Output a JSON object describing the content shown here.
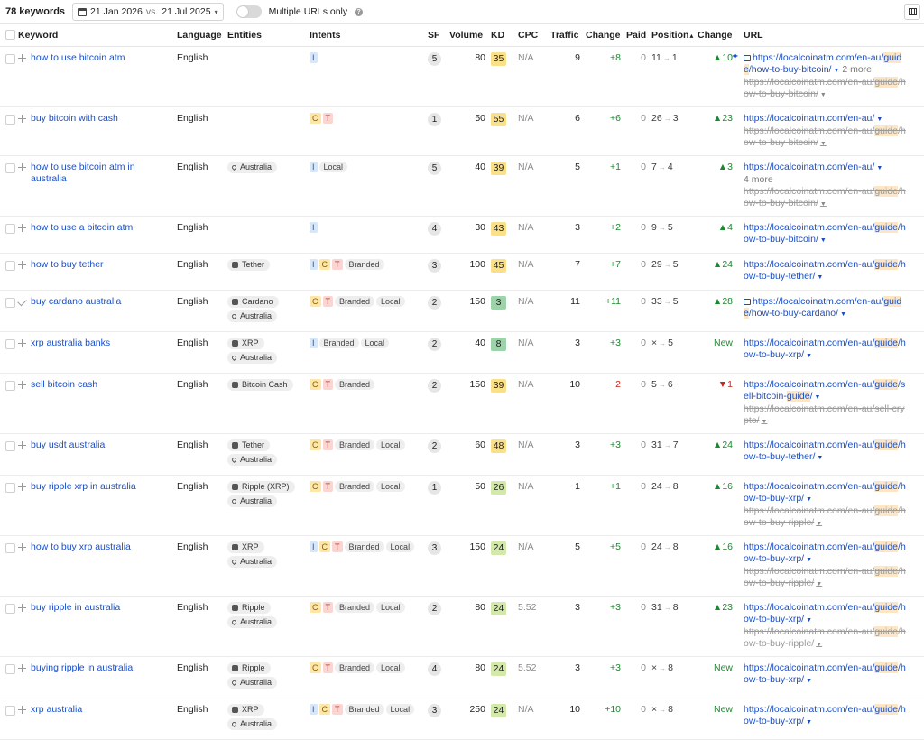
{
  "header": {
    "keyword_count": "78 keywords",
    "date_current": "21 Jan 2026",
    "vs": "vs.",
    "date_compare": "21 Jul 2025",
    "toggle_label": "Multiple URLs only",
    "help_glyph": "?"
  },
  "columns": [
    "Keyword",
    "Language",
    "Entities",
    "Intents",
    "SF",
    "Volume",
    "KD",
    "CPC",
    "Traffic",
    "Change",
    "Paid",
    "Position",
    "Change",
    "URL"
  ],
  "position_sort_glyph": "▴",
  "colors": {
    "link": "#1a4fc4",
    "green": "#1b8a2e",
    "red": "#c9261d",
    "kd_yellow": "#fbe08a",
    "kd_green": "#9cd3a8",
    "kd_lightgreen": "#d3e9a9"
  },
  "rows": [
    {
      "keyword": "how to use bitcoin atm",
      "language": "English",
      "entities": [],
      "intents": [
        "I"
      ],
      "sf": "5",
      "volume": "80",
      "kd": "35",
      "kd_color": "#fbe08a",
      "cpc": "N/A",
      "traffic": "9",
      "change": "+8",
      "change_dir": "up",
      "paid": "0",
      "pos_from": "11",
      "pos_to": "1",
      "pchange": "▲10",
      "pchange_dir": "up",
      "lead": "plus",
      "sparkle": true,
      "urls": [
        {
          "text": "https://localcoinatm.com/en-au/guid",
          "img": true
        },
        {
          "text": "e/how-to-buy-bitcoin/",
          "more": "2 more"
        },
        {
          "text": "https://localcoinatm.com/en-au/guide/h",
          "strike": true
        },
        {
          "text": "ow-to-buy-bitcoin/",
          "strike": true
        }
      ]
    },
    {
      "keyword": "buy bitcoin with cash",
      "language": "English",
      "entities": [],
      "intents": [
        "C",
        "T"
      ],
      "sf": "1",
      "volume": "50",
      "kd": "55",
      "kd_color": "#fbe08a",
      "cpc": "N/A",
      "traffic": "6",
      "change": "+6",
      "change_dir": "up",
      "paid": "0",
      "pos_from": "26",
      "pos_to": "3",
      "pchange": "▲23",
      "pchange_dir": "up",
      "lead": "plus",
      "urls": [
        {
          "text": "https://localcoinatm.com/en-au/"
        },
        {
          "text": "https://localcoinatm.com/en-au/guide/h",
          "strike": true
        },
        {
          "text": "ow-to-buy-bitcoin/",
          "strike": true
        }
      ]
    },
    {
      "keyword": "how to use bitcoin atm in australia",
      "language": "English",
      "entities": [
        "Australia"
      ],
      "intents": [
        "I",
        "Local"
      ],
      "sf": "5",
      "volume": "40",
      "kd": "39",
      "kd_color": "#fbe08a",
      "cpc": "N/A",
      "traffic": "5",
      "change": "+1",
      "change_dir": "up",
      "paid": "0",
      "pos_from": "7",
      "pos_to": "4",
      "pchange": "▲3",
      "pchange_dir": "up",
      "lead": "plus",
      "urls": [
        {
          "text": "https://localcoinatm.com/en-au/"
        },
        {
          "text": "4 more",
          "plain": true
        },
        {
          "text": "https://localcoinatm.com/en-au/guide/h",
          "strike": true
        },
        {
          "text": "ow-to-buy-bitcoin/",
          "strike": true
        }
      ]
    },
    {
      "keyword": "how to use a bitcoin atm",
      "language": "English",
      "entities": [],
      "intents": [
        "I"
      ],
      "sf": "4",
      "volume": "30",
      "kd": "43",
      "kd_color": "#fbe08a",
      "cpc": "N/A",
      "traffic": "3",
      "change": "+2",
      "change_dir": "up",
      "paid": "0",
      "pos_from": "9",
      "pos_to": "5",
      "pchange": "▲4",
      "pchange_dir": "up",
      "lead": "plus",
      "urls": [
        {
          "text": "https://localcoinatm.com/en-au/guide/h"
        },
        {
          "text": "ow-to-buy-bitcoin/"
        }
      ]
    },
    {
      "keyword": "how to buy tether",
      "language": "English",
      "entities": [
        "Tether"
      ],
      "intents": [
        "I",
        "C",
        "T",
        "Branded"
      ],
      "sf": "3",
      "volume": "100",
      "kd": "45",
      "kd_color": "#fbe08a",
      "cpc": "N/A",
      "traffic": "7",
      "change": "+7",
      "change_dir": "up",
      "paid": "0",
      "pos_from": "29",
      "pos_to": "5",
      "pchange": "▲24",
      "pchange_dir": "up",
      "lead": "plus",
      "urls": [
        {
          "text": "https://localcoinatm.com/en-au/guide/h"
        },
        {
          "text": "ow-to-buy-tether/"
        }
      ]
    },
    {
      "keyword": "buy cardano australia",
      "language": "English",
      "entities": [
        "Cardano",
        "Australia"
      ],
      "intents": [
        "C",
        "T",
        "Branded",
        "Local"
      ],
      "sf": "2",
      "volume": "150",
      "kd": "3",
      "kd_color": "#9cd3a8",
      "cpc": "N/A",
      "traffic": "11",
      "change": "+11",
      "change_dir": "up",
      "paid": "0",
      "pos_from": "33",
      "pos_to": "5",
      "pchange": "▲28",
      "pchange_dir": "up",
      "lead": "check",
      "urls": [
        {
          "text": "https://localcoinatm.com/en-au/guid",
          "img": true
        },
        {
          "text": "e/how-to-buy-cardano/"
        }
      ]
    },
    {
      "keyword": "xrp australia banks",
      "language": "English",
      "entities": [
        "XRP",
        "Australia"
      ],
      "intents": [
        "I",
        "Branded",
        "Local"
      ],
      "sf": "2",
      "volume": "40",
      "kd": "8",
      "kd_color": "#9cd3a8",
      "cpc": "N/A",
      "traffic": "3",
      "change": "+3",
      "change_dir": "up",
      "paid": "0",
      "pos_from": "×",
      "pos_to": "5",
      "pchange": "New",
      "pchange_dir": "up",
      "lead": "plus",
      "urls": [
        {
          "text": "https://localcoinatm.com/en-au/guide/h"
        },
        {
          "text": "ow-to-buy-xrp/"
        }
      ]
    },
    {
      "keyword": "sell bitcoin cash",
      "language": "English",
      "entities": [
        "Bitcoin Cash"
      ],
      "intents": [
        "C",
        "T",
        "Branded"
      ],
      "sf": "2",
      "volume": "150",
      "kd": "39",
      "kd_color": "#fbe08a",
      "cpc": "N/A",
      "traffic": "10",
      "change": "−2",
      "change_dir": "down",
      "paid": "0",
      "pos_from": "5",
      "pos_to": "6",
      "pchange": "▼1",
      "pchange_dir": "down",
      "lead": "plus",
      "urls": [
        {
          "text": "https://localcoinatm.com/en-au/guide/s"
        },
        {
          "text": "ell-bitcoin-guide/"
        },
        {
          "text": "https://localcoinatm.com/en-au/sell-cry",
          "strike": true
        },
        {
          "text": "pto/",
          "strike": true
        }
      ]
    },
    {
      "keyword": "buy usdt australia",
      "language": "English",
      "entities": [
        "Tether",
        "Australia"
      ],
      "intents": [
        "C",
        "T",
        "Branded",
        "Local"
      ],
      "sf": "2",
      "volume": "60",
      "kd": "48",
      "kd_color": "#fbe08a",
      "cpc": "N/A",
      "traffic": "3",
      "change": "+3",
      "change_dir": "up",
      "paid": "0",
      "pos_from": "31",
      "pos_to": "7",
      "pchange": "▲24",
      "pchange_dir": "up",
      "lead": "plus",
      "urls": [
        {
          "text": "https://localcoinatm.com/en-au/guide/h"
        },
        {
          "text": "ow-to-buy-tether/"
        }
      ]
    },
    {
      "keyword": "buy ripple xrp in australia",
      "language": "English",
      "entities": [
        "Ripple (XRP)",
        "Australia"
      ],
      "intents": [
        "C",
        "T",
        "Branded",
        "Local"
      ],
      "sf": "1",
      "volume": "50",
      "kd": "26",
      "kd_color": "#d3e9a9",
      "cpc": "N/A",
      "traffic": "1",
      "change": "+1",
      "change_dir": "up",
      "paid": "0",
      "pos_from": "24",
      "pos_to": "8",
      "pchange": "▲16",
      "pchange_dir": "up",
      "lead": "plus",
      "urls": [
        {
          "text": "https://localcoinatm.com/en-au/guide/h"
        },
        {
          "text": "ow-to-buy-xrp/"
        },
        {
          "text": "https://localcoinatm.com/en-au/guide/h",
          "strike": true
        },
        {
          "text": "ow-to-buy-ripple/",
          "strike": true
        }
      ]
    },
    {
      "keyword": "how to buy xrp australia",
      "language": "English",
      "entities": [
        "XRP",
        "Australia"
      ],
      "intents": [
        "I",
        "C",
        "T",
        "Branded",
        "Local"
      ],
      "sf": "3",
      "volume": "150",
      "kd": "24",
      "kd_color": "#d3e9a9",
      "cpc": "N/A",
      "traffic": "5",
      "change": "+5",
      "change_dir": "up",
      "paid": "0",
      "pos_from": "24",
      "pos_to": "8",
      "pchange": "▲16",
      "pchange_dir": "up",
      "lead": "plus",
      "urls": [
        {
          "text": "https://localcoinatm.com/en-au/guide/h"
        },
        {
          "text": "ow-to-buy-xrp/"
        },
        {
          "text": "https://localcoinatm.com/en-au/guide/h",
          "strike": true
        },
        {
          "text": "ow-to-buy-ripple/",
          "strike": true
        }
      ]
    },
    {
      "keyword": "buy ripple in australia",
      "language": "English",
      "entities": [
        "Ripple",
        "Australia"
      ],
      "intents": [
        "C",
        "T",
        "Branded",
        "Local"
      ],
      "sf": "2",
      "volume": "80",
      "kd": "24",
      "kd_color": "#d3e9a9",
      "cpc": "5.52",
      "traffic": "3",
      "change": "+3",
      "change_dir": "up",
      "paid": "0",
      "pos_from": "31",
      "pos_to": "8",
      "pchange": "▲23",
      "pchange_dir": "up",
      "lead": "plus",
      "urls": [
        {
          "text": "https://localcoinatm.com/en-au/guide/h"
        },
        {
          "text": "ow-to-buy-xrp/"
        },
        {
          "text": "https://localcoinatm.com/en-au/guide/h",
          "strike": true
        },
        {
          "text": "ow-to-buy-ripple/",
          "strike": true
        }
      ]
    },
    {
      "keyword": "buying ripple in australia",
      "language": "English",
      "entities": [
        "Ripple",
        "Australia"
      ],
      "intents": [
        "C",
        "T",
        "Branded",
        "Local"
      ],
      "sf": "4",
      "volume": "80",
      "kd": "24",
      "kd_color": "#d3e9a9",
      "cpc": "5.52",
      "traffic": "3",
      "change": "+3",
      "change_dir": "up",
      "paid": "0",
      "pos_from": "×",
      "pos_to": "8",
      "pchange": "New",
      "pchange_dir": "up",
      "lead": "plus",
      "urls": [
        {
          "text": "https://localcoinatm.com/en-au/guide/h"
        },
        {
          "text": "ow-to-buy-xrp/"
        }
      ]
    },
    {
      "keyword": "xrp australia",
      "language": "English",
      "entities": [
        "XRP",
        "Australia"
      ],
      "intents": [
        "I",
        "C",
        "T",
        "Branded",
        "Local"
      ],
      "sf": "3",
      "volume": "250",
      "kd": "24",
      "kd_color": "#d3e9a9",
      "cpc": "N/A",
      "traffic": "10",
      "change": "+10",
      "change_dir": "up",
      "paid": "0",
      "pos_from": "×",
      "pos_to": "8",
      "pchange": "New",
      "pchange_dir": "up",
      "lead": "plus",
      "urls": [
        {
          "text": "https://localcoinatm.com/en-au/guide/h"
        },
        {
          "text": "ow-to-buy-xrp/"
        }
      ]
    }
  ]
}
